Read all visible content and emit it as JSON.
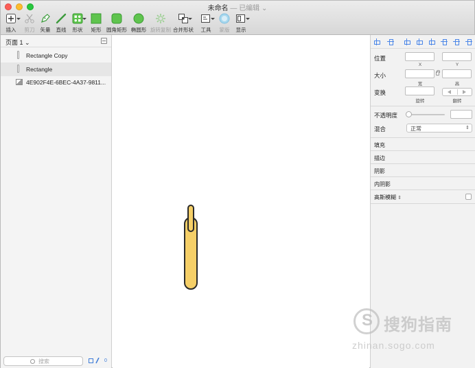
{
  "window": {
    "title": "未命名",
    "title_sep": " — ",
    "title_status": "已编辑",
    "title_caret": "⌄"
  },
  "toolbar": {
    "items": [
      {
        "label": "插入",
        "icon": "plus-icon"
      },
      {
        "label": "剪刀",
        "icon": "scissors-icon"
      },
      {
        "label": "矢量",
        "icon": "pen-icon"
      },
      {
        "label": "直线",
        "icon": "line-icon"
      },
      {
        "label": "形状",
        "icon": "shapes-icon"
      },
      {
        "label": "矩形",
        "icon": "rectangle-icon"
      },
      {
        "label": "圆角矩形",
        "icon": "rounded-rectangle-icon"
      },
      {
        "label": "椭圆形",
        "icon": "oval-icon"
      },
      {
        "label": "旋转复制",
        "icon": "rotate-copy-icon"
      },
      {
        "label": "合并形状",
        "icon": "combine-shapes-icon"
      },
      {
        "label": "工具",
        "icon": "tools-icon"
      },
      {
        "label": "蒙版",
        "icon": "mask-icon"
      },
      {
        "label": "显示",
        "icon": "view-icon"
      }
    ]
  },
  "layers_panel": {
    "page_label": "页面 1",
    "page_caret": "⌄",
    "layers": [
      {
        "name": "Rectangle Copy",
        "type": "shape"
      },
      {
        "name": "Rectangle",
        "type": "shape",
        "selected": true
      },
      {
        "name": "4E902F4E-6BEC-4A37-9811...",
        "type": "image"
      }
    ],
    "search_placeholder": "搜索",
    "badge_count": "0"
  },
  "inspector": {
    "position_label": "位置",
    "x_label": "X",
    "y_label": "Y",
    "size_label": "大小",
    "width_label": "宽",
    "height_label": "高",
    "transform_label": "变换",
    "rotate_label": "旋转",
    "flip_label": "翻转",
    "opacity_label": "不透明度",
    "blend_label": "混合",
    "blend_value": "正常",
    "fill_label": "填充",
    "border_label": "描边",
    "shadow_label": "阴影",
    "inner_shadow_label": "内阴影",
    "blur_label": "高斯模糊",
    "updown": "⇕"
  },
  "canvas": {
    "shape_fill": "#f5cf67",
    "shape_stroke": "#2a2a2a"
  },
  "watermark": {
    "logo_glyph": "S",
    "brand": "搜狗指南",
    "url": "zhinan.sogo.com"
  }
}
